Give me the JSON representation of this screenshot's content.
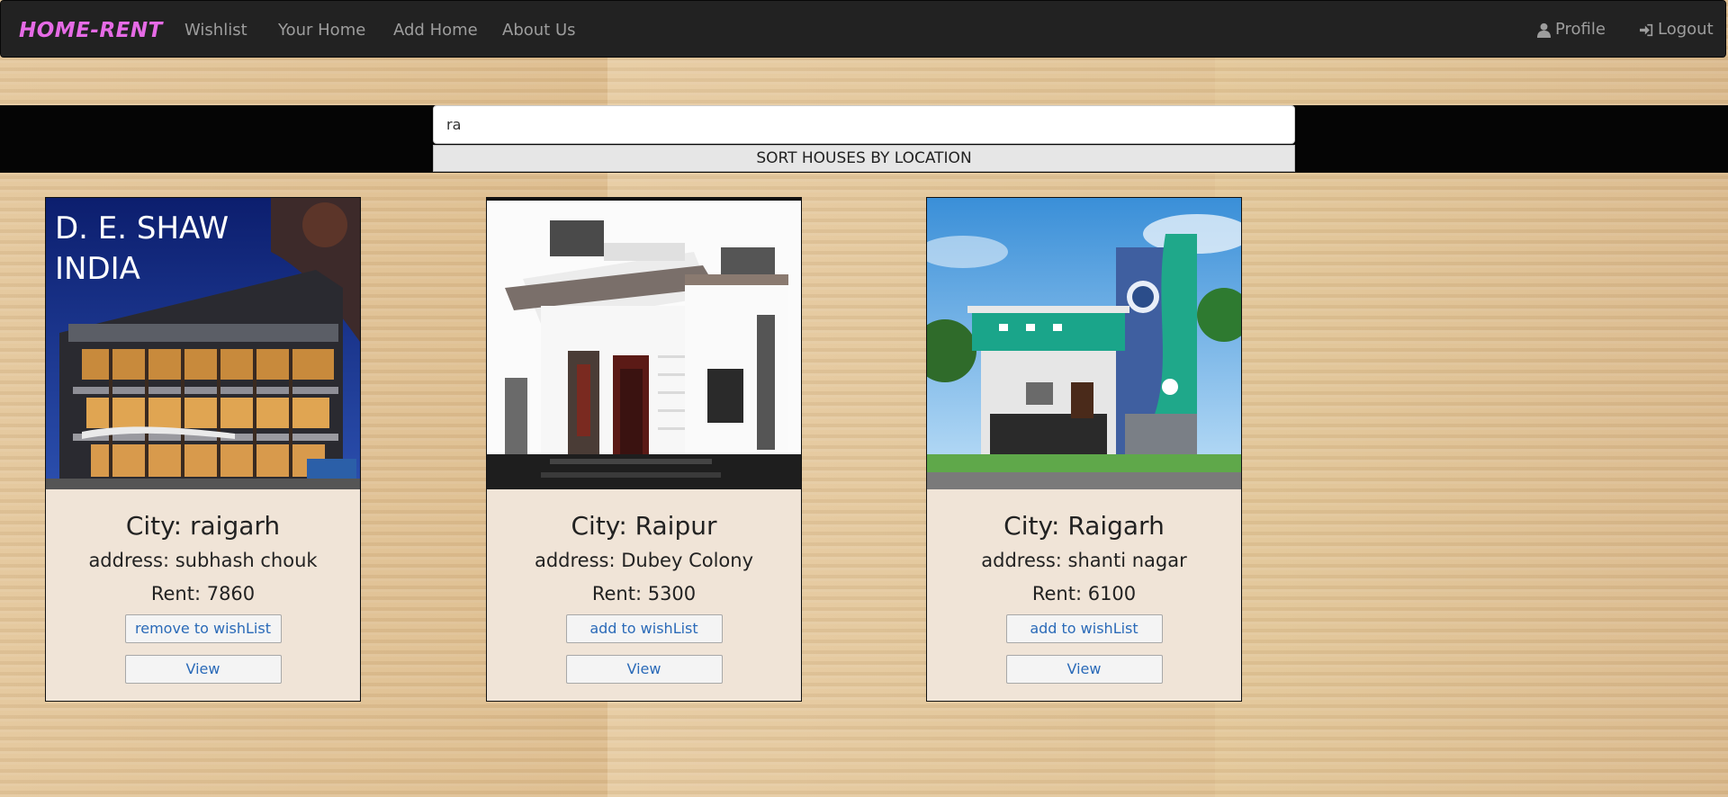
{
  "nav": {
    "brand": "HOME-RENT",
    "links": [
      "Wishlist",
      "Your Home",
      "Add Home",
      "About Us"
    ],
    "profile_label": "Profile",
    "logout_label": "Logout",
    "profile_icon": "user-icon",
    "logout_icon": "log-in-icon"
  },
  "search": {
    "value": "ra",
    "sort_label": "SORT HOUSES BY LOCATION"
  },
  "cards": [
    {
      "city": "City: raigarh",
      "address": "address: subhash chouk",
      "rent": "Rent: 7860",
      "wish_label": "remove to wishList",
      "view_label": "View",
      "image_text_1": "D. E. SHAW",
      "image_text_2": "INDIA"
    },
    {
      "city": "City: Raipur",
      "address": "address: Dubey Colony",
      "rent": "Rent: 5300",
      "wish_label": "add to wishList",
      "view_label": "View"
    },
    {
      "city": "City: Raigarh",
      "address": "address: shanti nagar",
      "rent": "Rent: 6100",
      "wish_label": "add to wishList",
      "view_label": "View"
    }
  ],
  "colors": {
    "brand": "#e66be6",
    "navbar": "#222222",
    "card_bg": "#f0e4d7",
    "link": "#2a6ab8"
  }
}
